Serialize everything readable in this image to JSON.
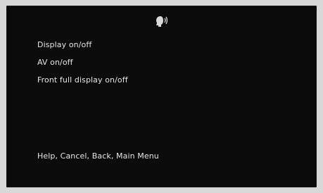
{
  "header": {
    "icon": "voice-recognition-icon"
  },
  "menu": {
    "items": [
      {
        "label": "Display on/off"
      },
      {
        "label": "AV on/off"
      },
      {
        "label": "Front full display on/off"
      }
    ]
  },
  "footer": {
    "commands": "Help, Cancel, Back, Main Menu"
  },
  "colors": {
    "background": "#0b0b0b",
    "text": "#e6e6e6",
    "outer": "#d8d8d8"
  }
}
